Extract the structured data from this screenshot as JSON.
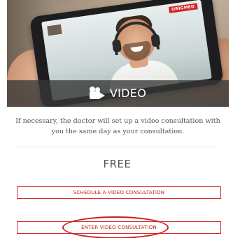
{
  "hero": {
    "screen_logo": "ORIGMED",
    "video_label": "VIDEO",
    "camera_icon": "video-camera-icon"
  },
  "description": "If necessary, the doctor will set up a video consultation with you the same day as your consultation.",
  "price": "FREE",
  "buttons": {
    "schedule": "SCHEDULE A VIDEO CONSULTATION",
    "enter": "ENTER VIDEO CONSULTATION"
  },
  "colors": {
    "accent": "#d52b2b",
    "annotation_circle": "#d01919",
    "overlay": "#373737"
  }
}
